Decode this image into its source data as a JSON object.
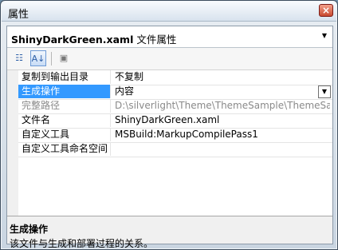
{
  "window": {
    "title": "属性",
    "close_glyph": "×"
  },
  "selector": {
    "object_name": "ShinyDarkGreen.xaml",
    "object_type": "文件属性"
  },
  "toolbar": {
    "categorized_icon": "categorized-icon",
    "alphabetical_icon": "alphabetical-icon",
    "property_pages_icon": "property-pages-icon"
  },
  "properties": [
    {
      "name": "复制到输出目录",
      "value": "不复制"
    },
    {
      "name": "生成操作",
      "value": "内容",
      "selected": true
    },
    {
      "name": "完整路径",
      "value": "D:\\silverlight\\Theme\\ThemeSample\\ThemeSample\\Themes\\ShinyDarkGreen.xaml",
      "disabled": true
    },
    {
      "name": "文件名",
      "value": "ShinyDarkGreen.xaml"
    },
    {
      "name": "自定义工具",
      "value": "MSBuild:MarkupCompilePass1"
    },
    {
      "name": "自定义工具命名空间",
      "value": ""
    }
  ],
  "description": {
    "title": "生成操作",
    "text": "该文件与生成和部署过程的关系。"
  },
  "colors": {
    "selected": "#3399ff",
    "title_bar": "#d8e3ee"
  }
}
